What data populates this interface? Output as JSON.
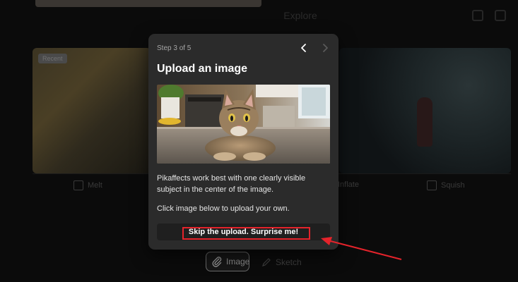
{
  "background": {
    "title": "Explore",
    "left_card_badge": "Recent",
    "left_label": "Melt",
    "mid_label": "Inflate",
    "right_label": "Squish"
  },
  "toolbar": {
    "image_label": "Image",
    "sketch_label": "Sketch"
  },
  "popup": {
    "step": "Step 3 of 5",
    "title": "Upload an image",
    "description": "Pikaffects work best with one clearly visible subject in the center of the image.",
    "hint": "Click image below to upload your own.",
    "skip_label": "Skip the upload. Surprise me!"
  },
  "annotation": {
    "color": "#e5232b"
  }
}
